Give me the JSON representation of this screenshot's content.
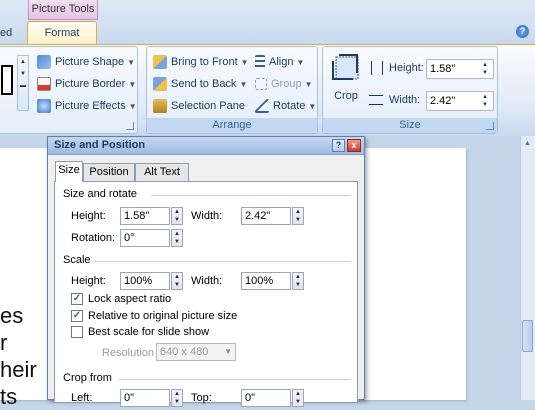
{
  "ribbon": {
    "context_label": "Picture Tools",
    "prev_tab": "ed",
    "active_tab": "Format",
    "adjust": {
      "picture_shape": "Picture Shape",
      "picture_border": "Picture Border",
      "picture_effects": "Picture Effects"
    },
    "arrange": {
      "label": "Arrange",
      "bring_to_front": "Bring to Front",
      "send_to_back": "Send to Back",
      "selection_pane": "Selection Pane",
      "align": "Align",
      "group": "Group",
      "rotate": "Rotate"
    },
    "size": {
      "label": "Size",
      "crop": "Crop",
      "height_label": "Height:",
      "height_value": "1.58\"",
      "width_label": "Width:",
      "width_value": "2.42\""
    }
  },
  "document": {
    "lines": [
      "es",
      "r",
      "heir",
      "ts"
    ]
  },
  "dialog": {
    "title": "Size and Position",
    "help": "?",
    "close": "x",
    "tabs": [
      "Size",
      "Position",
      "Alt Text"
    ],
    "size_rotate": {
      "heading": "Size and rotate",
      "height_label": "Height:",
      "height_value": "1.58\"",
      "width_label": "Width:",
      "width_value": "2.42\"",
      "rotation_label": "Rotation:",
      "rotation_value": "0°"
    },
    "scale": {
      "heading": "Scale",
      "height_label": "Height:",
      "height_value": "100%",
      "width_label": "Width:",
      "width_value": "100%",
      "lock_aspect": "Lock aspect ratio",
      "lock_aspect_checked": true,
      "relative": "Relative to original picture size",
      "relative_checked": true,
      "best_scale": "Best scale for slide show",
      "best_scale_checked": false,
      "resolution_label": "Resolution",
      "resolution_value": "640 x 480"
    },
    "crop": {
      "heading": "Crop from",
      "left_label": "Left:",
      "left_value": "0\"",
      "top_label": "Top:",
      "top_value": "0\""
    }
  }
}
